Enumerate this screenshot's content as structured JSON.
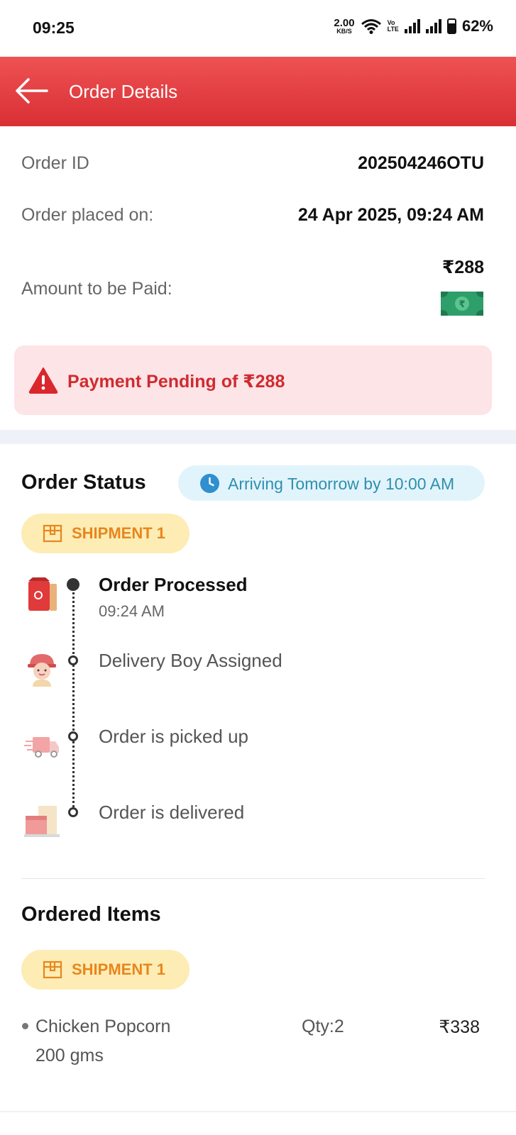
{
  "status_bar": {
    "time": "09:25",
    "net_speed_value": "2.00",
    "net_speed_unit": "KB/S",
    "volte_top": "Vo",
    "volte_bottom": "LTE",
    "battery": "62%"
  },
  "header": {
    "title": "Order Details",
    "background": "#e63c41"
  },
  "order_info": {
    "order_id_label": "Order ID",
    "order_id_value": "202504246OTU",
    "placed_on_label": "Order placed on:",
    "placed_on_value": "24 Apr 2025, 09:24 AM",
    "amount_label": "Amount to be Paid:",
    "amount_value": "₹288",
    "payment_icon": "cash-icon"
  },
  "payment_alert": {
    "text": "Payment Pending of ₹288",
    "icon": "warning-icon",
    "color": "#cf2b30"
  },
  "order_status": {
    "title": "Order Status",
    "eta": "Arriving Tomorrow by 10:00 AM",
    "shipment_label": "SHIPMENT 1",
    "steps": [
      {
        "label": "Order Processed",
        "time": "09:24 AM",
        "icon": "bag-icon"
      },
      {
        "label": "Delivery Boy Assigned",
        "icon": "delivery-boy-icon"
      },
      {
        "label": "Order is picked up",
        "icon": "delivery-truck-icon"
      },
      {
        "label": "Order is delivered",
        "icon": "package-icon"
      }
    ]
  },
  "ordered_items": {
    "title": "Ordered Items",
    "shipment_label": "SHIPMENT 1",
    "items": [
      {
        "name": "Chicken Popcorn",
        "variant": "200 gms",
        "qty": "Qty:2",
        "price": "₹338"
      }
    ]
  }
}
